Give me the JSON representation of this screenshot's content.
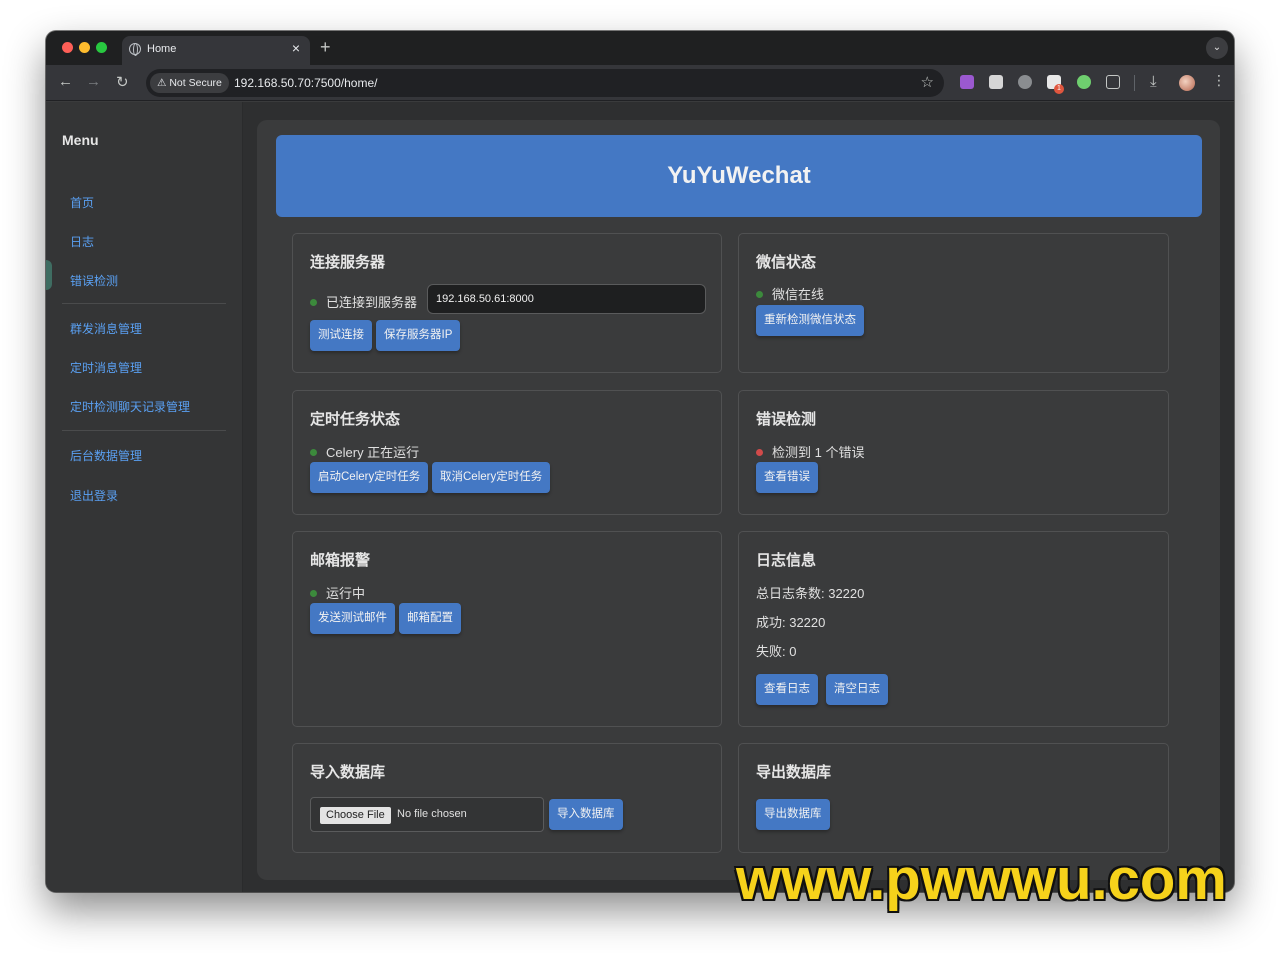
{
  "browser": {
    "tab_title": "Home",
    "tab_close": "×",
    "new_tab": "+",
    "tab_menu": "⌄",
    "security_label": "Not Secure",
    "url": "192.168.50.70:7500/home/",
    "extension_badge": "1"
  },
  "sidebar": {
    "title": "Menu",
    "items": [
      {
        "label": "首页"
      },
      {
        "label": "日志"
      },
      {
        "label": "错误检测"
      },
      {
        "label": "群发消息管理"
      },
      {
        "label": "定时消息管理"
      },
      {
        "label": "定时检测聊天记录管理"
      },
      {
        "label": "后台数据管理"
      },
      {
        "label": "退出登录"
      }
    ]
  },
  "banner": {
    "title": "YuYuWechat"
  },
  "cards": {
    "server": {
      "title": "连接服务器",
      "status": "已连接到服务器",
      "ip_value": "192.168.50.61:8000",
      "btn_test": "测试连接",
      "btn_save": "保存服务器IP"
    },
    "wechat": {
      "title": "微信状态",
      "status": "微信在线",
      "btn_recheck": "重新检测微信状态"
    },
    "celery": {
      "title": "定时任务状态",
      "status": "Celery 正在运行",
      "btn_start": "启动Celery定时任务",
      "btn_cancel": "取消Celery定时任务"
    },
    "errors": {
      "title": "错误检测",
      "status": "检测到 1 个错误",
      "btn_view": "查看错误"
    },
    "mail": {
      "title": "邮箱报警",
      "status": "运行中",
      "btn_test": "发送测试邮件",
      "btn_config": "邮箱配置"
    },
    "log": {
      "title": "日志信息",
      "total": "总日志条数: 32220",
      "success": "成功: 32220",
      "fail": "失败: 0",
      "btn_view": "查看日志",
      "btn_clear": "清空日志"
    },
    "import": {
      "title": "导入数据库",
      "file_button": "Choose File",
      "file_status": "No file chosen",
      "btn_import": "导入数据库"
    },
    "export": {
      "title": "导出数据库",
      "btn_export": "导出数据库"
    }
  },
  "watermark": "www.pwwwu.com",
  "colors": {
    "accent": "#4478c4",
    "link": "#5aa0f2",
    "ok": "#3c8a3c",
    "error": "#d14a4a"
  }
}
